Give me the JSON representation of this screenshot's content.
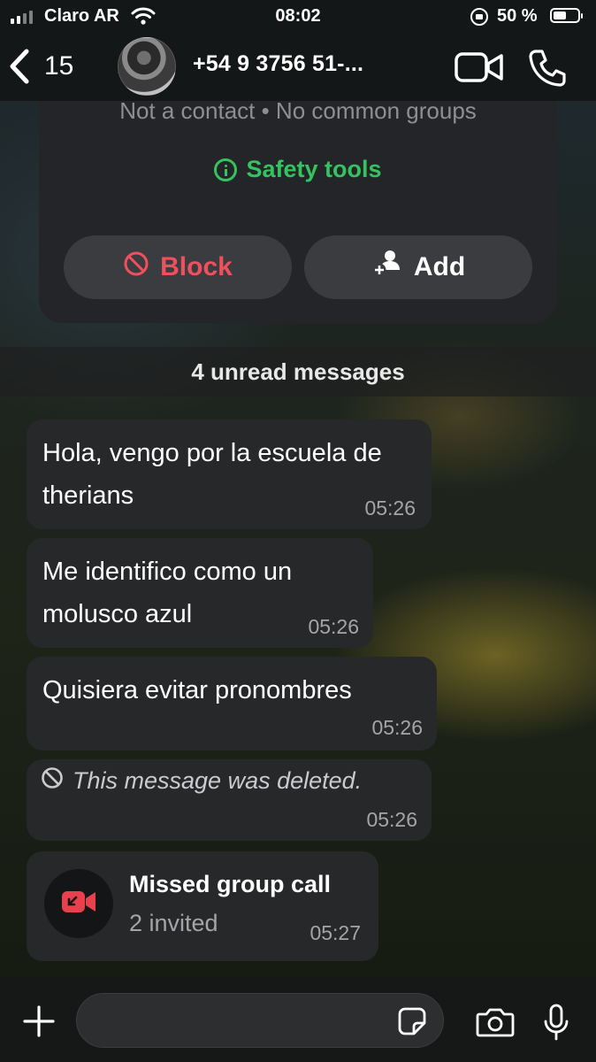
{
  "status_bar": {
    "carrier": "Claro AR",
    "time": "08:02",
    "battery": "50 %"
  },
  "header": {
    "back_count": "15",
    "contact_name": "+54 9 3756 51-..."
  },
  "contact_card": {
    "subtitle": "Not a contact • No common groups",
    "safety_tools": "Safety tools",
    "block_label": "Block",
    "add_label": "Add"
  },
  "unread_divider": "4 unread messages",
  "messages": [
    {
      "text": "Hola, vengo por la escuela de therians",
      "time": "05:26"
    },
    {
      "text": "Me identifico como un molusco azul",
      "time": "05:26"
    },
    {
      "text": "Quisiera evitar pronombres",
      "time": "05:26"
    },
    {
      "text": "This message was deleted.",
      "time": "05:26"
    }
  ],
  "missed_call": {
    "title": "Missed group call",
    "subtitle": "2 invited",
    "time": "05:27"
  },
  "composer": {
    "input_value": "",
    "input_placeholder": ""
  },
  "colors": {
    "accent_green": "#34c35f",
    "block_red": "#f0505d",
    "missed_call_red": "#e8404c",
    "bubble": "#262829"
  },
  "icons": [
    "back-chevron-icon",
    "video-call-icon",
    "phone-icon",
    "info-icon",
    "block-icon",
    "add-contact-icon",
    "deleted-icon",
    "missed-video-call-icon",
    "plus-icon",
    "sticker-icon",
    "camera-icon",
    "microphone-icon"
  ]
}
